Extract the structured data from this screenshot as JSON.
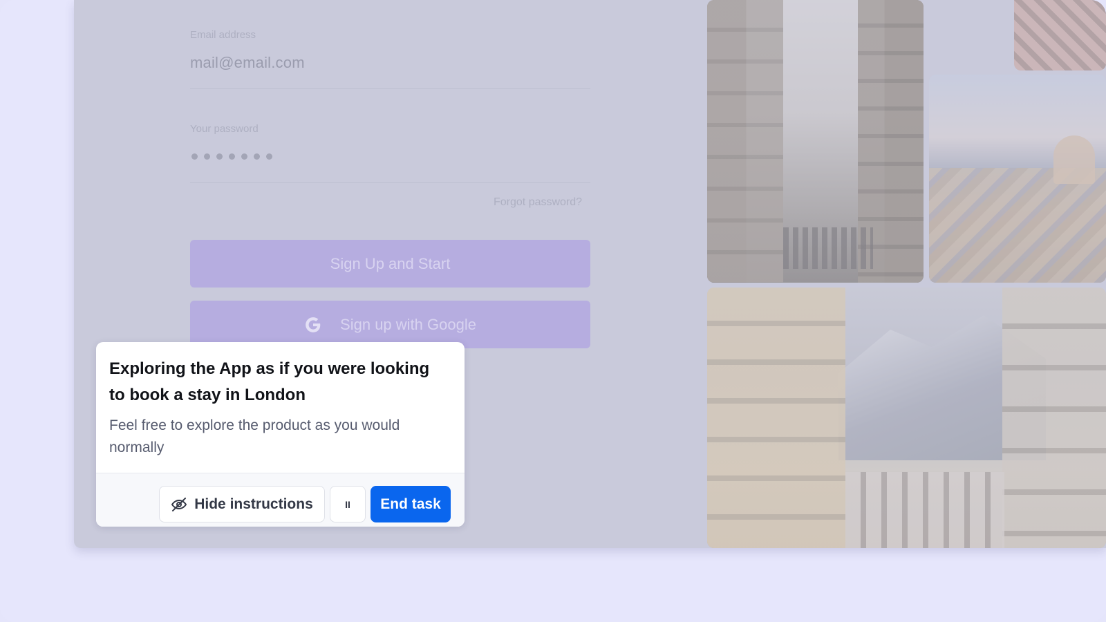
{
  "login_form": {
    "email_label": "Email address",
    "email_value": "mail@email.com",
    "password_label": "Your password",
    "password_masked": "•••••••",
    "forgot_password": "Forgot password?",
    "signup_button": "Sign Up and Start",
    "google_button": "Sign up with Google",
    "google_icon": "google-g-icon"
  },
  "instruction_card": {
    "title": "Exploring the App as if you were looking to book a stay in London",
    "body": "Feel free to explore the product as you would normally",
    "hide_button": "Hide instructions",
    "hide_icon": "eye-off-icon",
    "pause_button": "II",
    "end_button": "End task"
  },
  "colors": {
    "page_bg": "#e6e6fc",
    "overlay": "#c9cadb",
    "primary_button_dimmed": "#b6ade0",
    "end_task_blue": "#0a66ee"
  }
}
